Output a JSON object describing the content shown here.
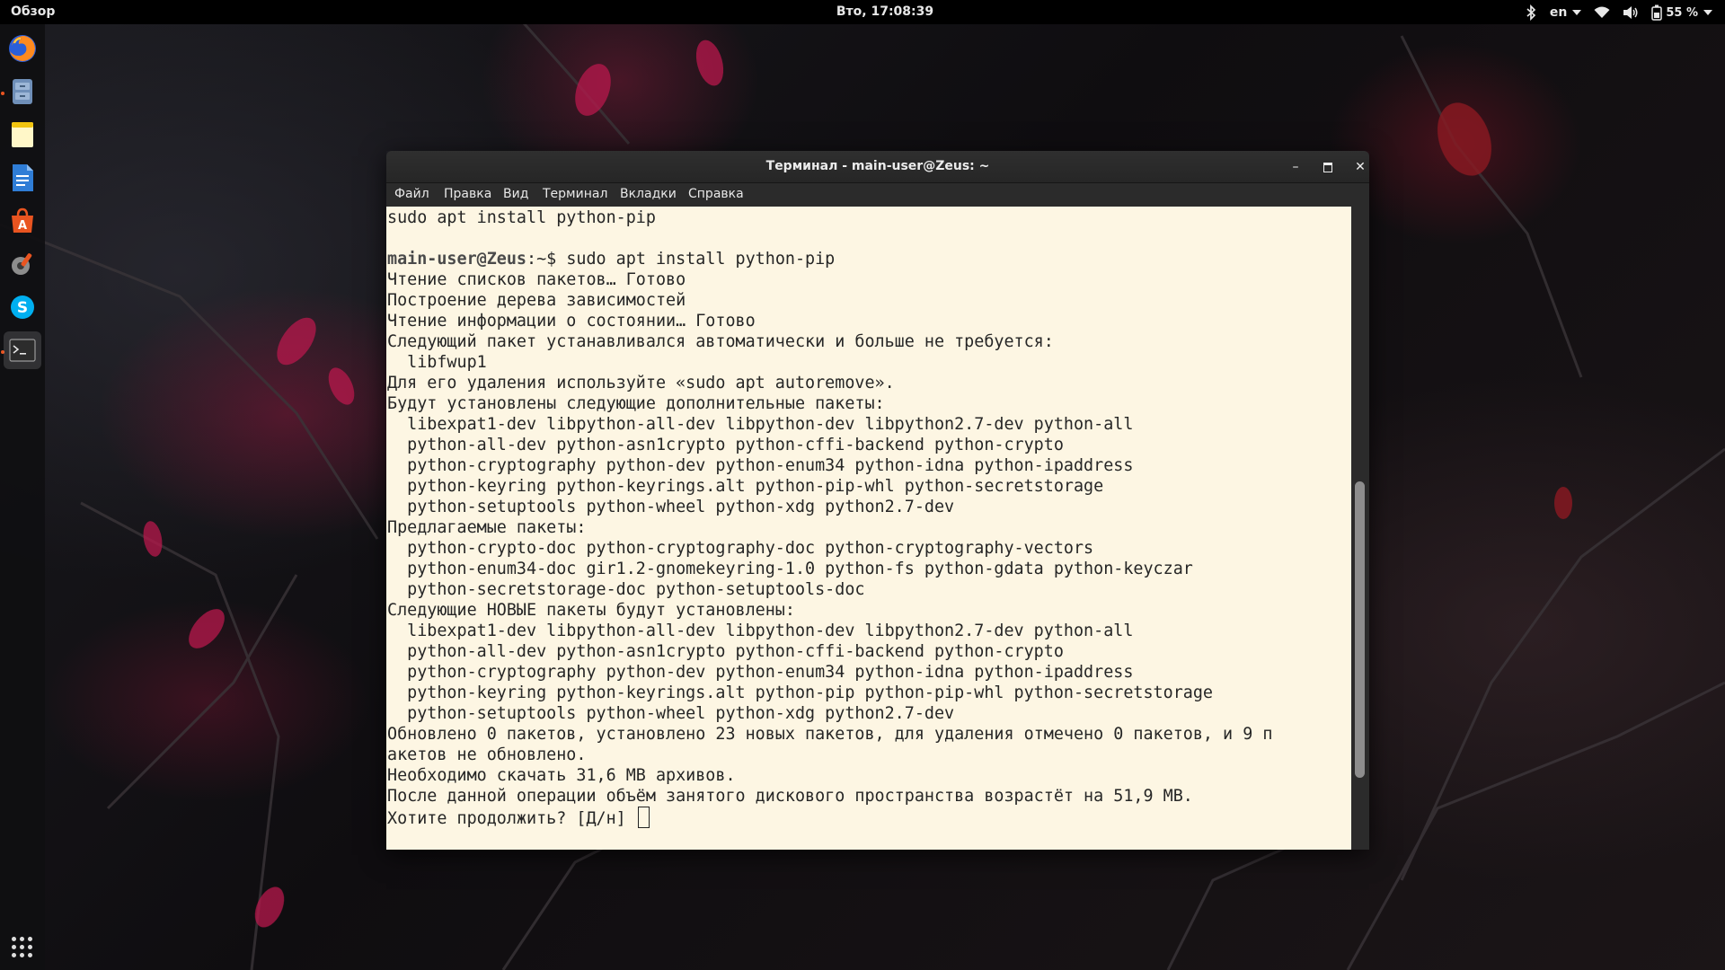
{
  "topbar": {
    "activities": "Обзор",
    "clock": "Вто, 17:08:39",
    "language": "en",
    "battery": "55 %"
  },
  "dock": {
    "items": [
      {
        "name": "firefox",
        "icon": "firefox-icon"
      },
      {
        "name": "files",
        "icon": "file-manager-icon"
      },
      {
        "name": "notes",
        "icon": "notes-icon"
      },
      {
        "name": "writer",
        "icon": "document-icon"
      },
      {
        "name": "software",
        "icon": "software-store-icon"
      },
      {
        "name": "settings",
        "icon": "settings-icon"
      },
      {
        "name": "skype",
        "icon": "skype-icon"
      },
      {
        "name": "terminal",
        "icon": "terminal-icon"
      }
    ]
  },
  "window": {
    "title": "Терминал - main-user@Zeus: ~",
    "minimize": "–",
    "maximize": "▫",
    "close": "✕"
  },
  "menu": {
    "file": "Файл",
    "edit": "Правка",
    "view": "Вид",
    "terminal": "Терминал",
    "tabs": "Вкладки",
    "help": "Справка"
  },
  "terminal": {
    "line_prev_cmd": "sudo apt install python-pip",
    "prompt_user": "main-user@Zeus",
    "prompt_path": ":~$ ",
    "command": "sudo apt install python-pip",
    "output_lines": [
      "Чтение списков пакетов… Готово",
      "Построение дерева зависимостей",
      "Чтение информации о состоянии… Готово",
      "Следующий пакет устанавливался автоматически и больше не требуется:",
      "  libfwup1",
      "Для его удаления используйте «sudo apt autoremove».",
      "Будут установлены следующие дополнительные пакеты:",
      "  libexpat1-dev libpython-all-dev libpython-dev libpython2.7-dev python-all",
      "  python-all-dev python-asn1crypto python-cffi-backend python-crypto",
      "  python-cryptography python-dev python-enum34 python-idna python-ipaddress",
      "  python-keyring python-keyrings.alt python-pip-whl python-secretstorage",
      "  python-setuptools python-wheel python-xdg python2.7-dev",
      "Предлагаемые пакеты:",
      "  python-crypto-doc python-cryptography-doc python-cryptography-vectors",
      "  python-enum34-doc gir1.2-gnomekeyring-1.0 python-fs python-gdata python-keyczar",
      "  python-secretstorage-doc python-setuptools-doc",
      "Следующие НОВЫЕ пакеты будут установлены:",
      "  libexpat1-dev libpython-all-dev libpython-dev libpython2.7-dev python-all",
      "  python-all-dev python-asn1crypto python-cffi-backend python-crypto",
      "  python-cryptography python-dev python-enum34 python-idna python-ipaddress",
      "  python-keyring python-keyrings.alt python-pip python-pip-whl python-secretstorage",
      "  python-setuptools python-wheel python-xdg python2.7-dev",
      "Обновлено 0 пакетов, установлено 23 новых пакетов, для удаления отмечено 0 пакетов, и 9 п",
      "акетов не обновлено.",
      "Необходимо скачать 31,6 MB архивов.",
      "После данной операции объём занятого дискового пространства возрастёт на 51,9 MB."
    ],
    "question": "Хотите продолжить? [Д/н] "
  },
  "colors": {
    "terminal_bg": "#fdf6e3",
    "accent": "#e95420"
  }
}
